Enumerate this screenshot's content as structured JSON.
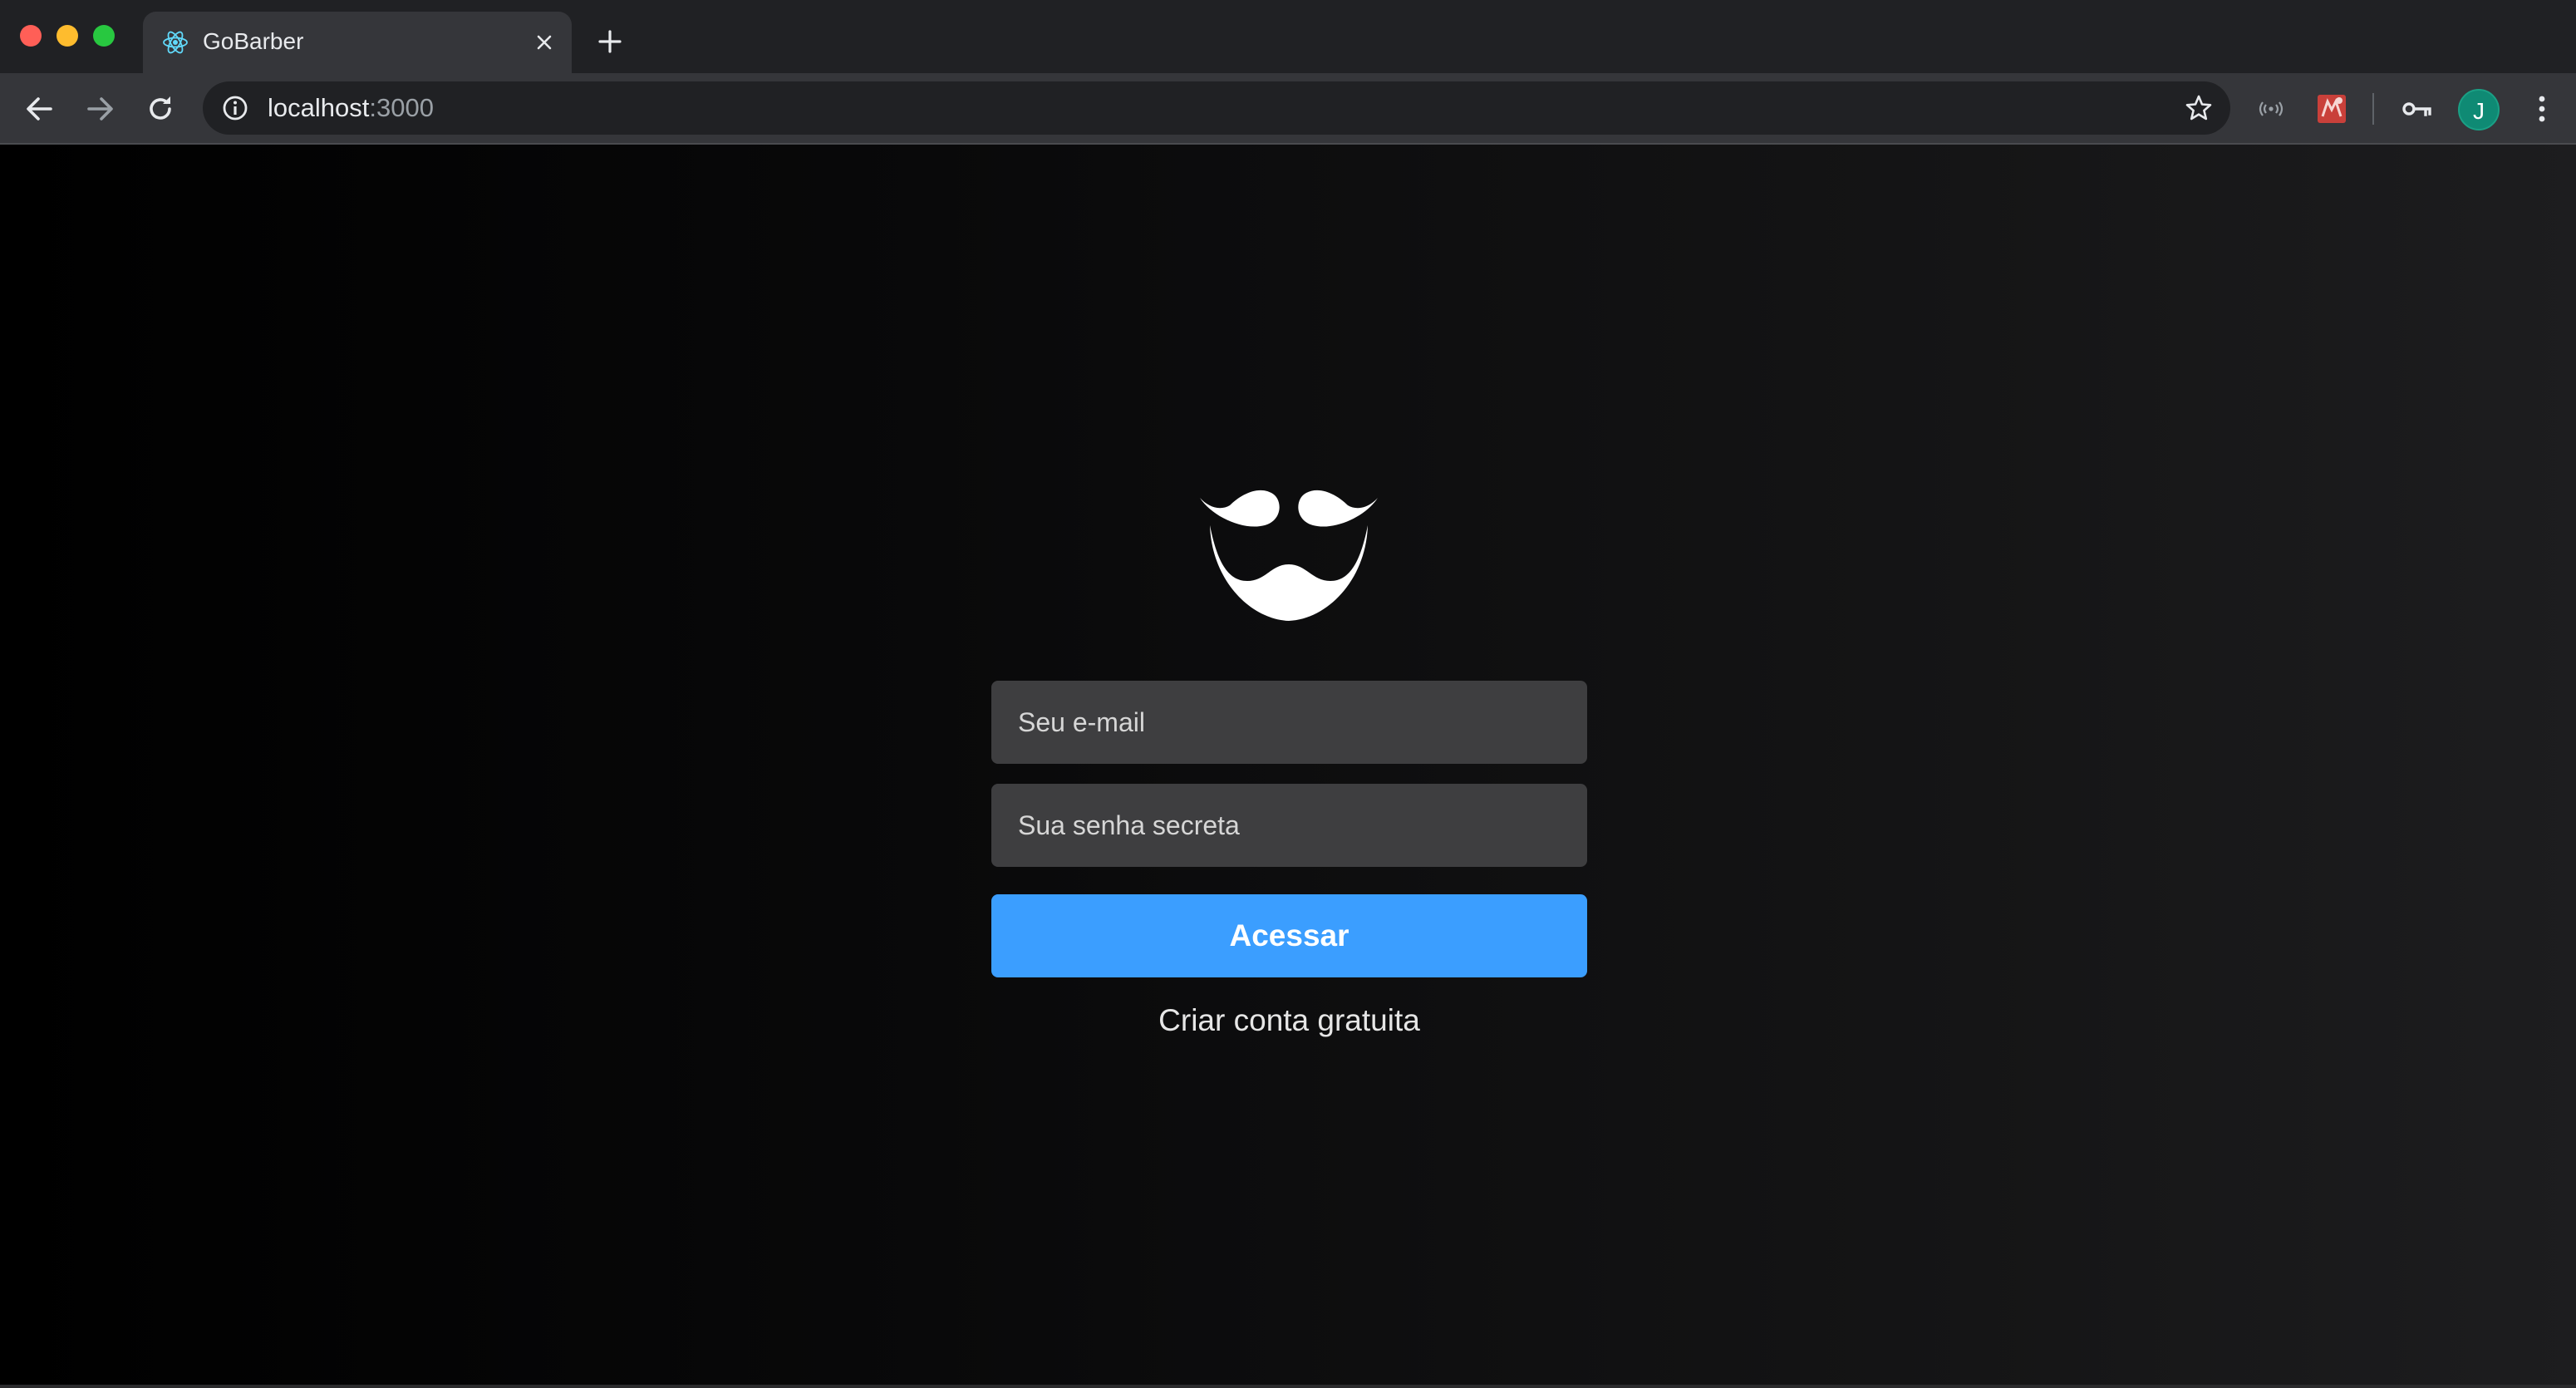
{
  "browser": {
    "tab": {
      "title": "GoBarber",
      "favicon": "react-icon"
    },
    "omnibox": {
      "host": "localhost",
      "port": ":3000"
    },
    "profile": {
      "initial": "J",
      "color": "#0f8a74"
    }
  },
  "page": {
    "logo": "mustache-beard-logo",
    "email_placeholder": "Seu e-mail",
    "password_placeholder": "Sua senha secreta",
    "submit_label": "Acessar",
    "signup_link": "Criar conta gratuita",
    "accent_color": "#3b9eff"
  }
}
